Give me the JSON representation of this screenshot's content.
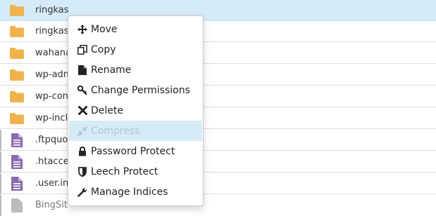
{
  "files": [
    {
      "name": "ringkas",
      "icon": "folder-icon",
      "selected": true
    },
    {
      "name": "ringkas",
      "icon": "folder-icon",
      "selected": false
    },
    {
      "name": "wahana",
      "icon": "folder-icon",
      "selected": false
    },
    {
      "name": "wp-adm",
      "icon": "folder-icon",
      "selected": false
    },
    {
      "name": "wp-con",
      "icon": "folder-icon",
      "selected": false
    },
    {
      "name": "wp-inclu",
      "icon": "folder-icon",
      "selected": false
    },
    {
      "name": ".ftpquo",
      "icon": "file-icon",
      "selected": false
    },
    {
      "name": ".htacce",
      "icon": "file-icon",
      "selected": false
    },
    {
      "name": ".user.in",
      "icon": "file-icon",
      "selected": false
    },
    {
      "name": "BingSit",
      "icon": "file-icon",
      "selected": false
    }
  ],
  "menu": {
    "items": [
      {
        "label": "Move",
        "icon": "move-arrows-icon"
      },
      {
        "label": "Copy",
        "icon": "copy-icon"
      },
      {
        "label": "Rename",
        "icon": "file-rename-icon"
      },
      {
        "label": "Change Permissions",
        "icon": "key-icon"
      },
      {
        "label": "Delete",
        "icon": "x-delete-icon"
      },
      {
        "label": "Compress",
        "icon": "compress-icon",
        "highlighted": true
      },
      {
        "label": "Password Protect",
        "icon": "lock-icon"
      },
      {
        "label": "Leech Protect",
        "icon": "shield-icon"
      },
      {
        "label": "Manage Indices",
        "icon": "wrench-icon"
      }
    ]
  },
  "colors": {
    "folder": "#f0b24a",
    "file": "#8a6bb0",
    "selection": "#d6ebf8"
  }
}
